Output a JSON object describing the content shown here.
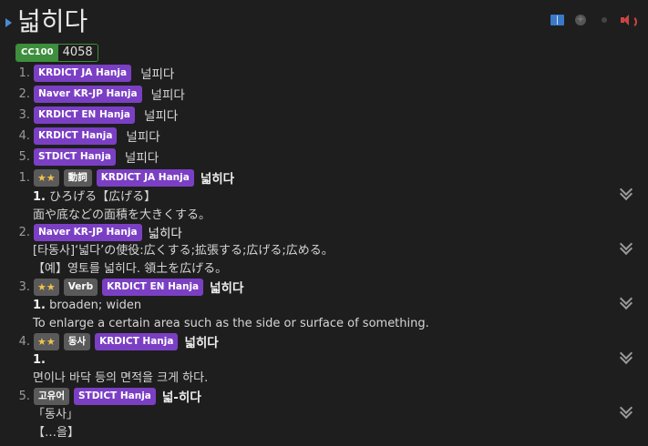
{
  "header": {
    "word": "넓히다",
    "icons": [
      "book-icon",
      "add-icon",
      "dot-icon",
      "speaker-icon"
    ]
  },
  "frequency": {
    "label": "CC100",
    "value": "4058"
  },
  "readings": [
    {
      "num": "1.",
      "source": "KRDICT JA Hanja",
      "reading": "널피다"
    },
    {
      "num": "2.",
      "source": "Naver KR-JP Hanja",
      "reading": "널피다"
    },
    {
      "num": "3.",
      "source": "KRDICT EN Hanja",
      "reading": "널피다"
    },
    {
      "num": "4.",
      "source": "KRDICT Hanja",
      "reading": "널피다"
    },
    {
      "num": "5.",
      "source": "STDICT Hanja",
      "reading": "널피다"
    }
  ],
  "definitions": [
    {
      "num": "1.",
      "stars": "★★",
      "pos": "動詞",
      "source": "KRDICT JA Hanja",
      "headword": "넓히다",
      "lines": [
        {
          "bold": "1.",
          "text": " ひろげる【広げる】"
        },
        {
          "bold": "",
          "text": "面や底などの面積を大きくする。"
        }
      ]
    },
    {
      "num": "2.",
      "stars": "",
      "pos": "",
      "source": "Naver KR-JP Hanja",
      "headword": "넓히다",
      "lines": [
        {
          "bold": "",
          "text": "[타동사]‘넓다’の使役:広くする;拡張する;広げる;広める。"
        },
        {
          "bold": "",
          "text": "【예】영토를 넓히다. 領土を広げる。"
        }
      ]
    },
    {
      "num": "3.",
      "stars": "★★",
      "pos": "Verb",
      "source": "KRDICT EN Hanja",
      "headword": "넓히다",
      "lines": [
        {
          "bold": "1.",
          "text": " broaden; widen"
        },
        {
          "bold": "",
          "text": "To enlarge a certain area such as the side or surface of something."
        }
      ]
    },
    {
      "num": "4.",
      "stars": "★★",
      "pos": "동사",
      "source": "KRDICT Hanja",
      "headword": "넓히다",
      "lines": [
        {
          "bold": "1.",
          "text": ""
        },
        {
          "bold": "",
          "text": "면이나 바닥 등의 면적을 크게 하다."
        }
      ]
    },
    {
      "num": "5.",
      "stars": "",
      "pos": "고유어",
      "source": "STDICT Hanja",
      "headword": "넓-히다",
      "lines": [
        {
          "bold": "",
          "text": "「동사」"
        },
        {
          "bold": "",
          "text": "【…을】"
        }
      ]
    }
  ]
}
